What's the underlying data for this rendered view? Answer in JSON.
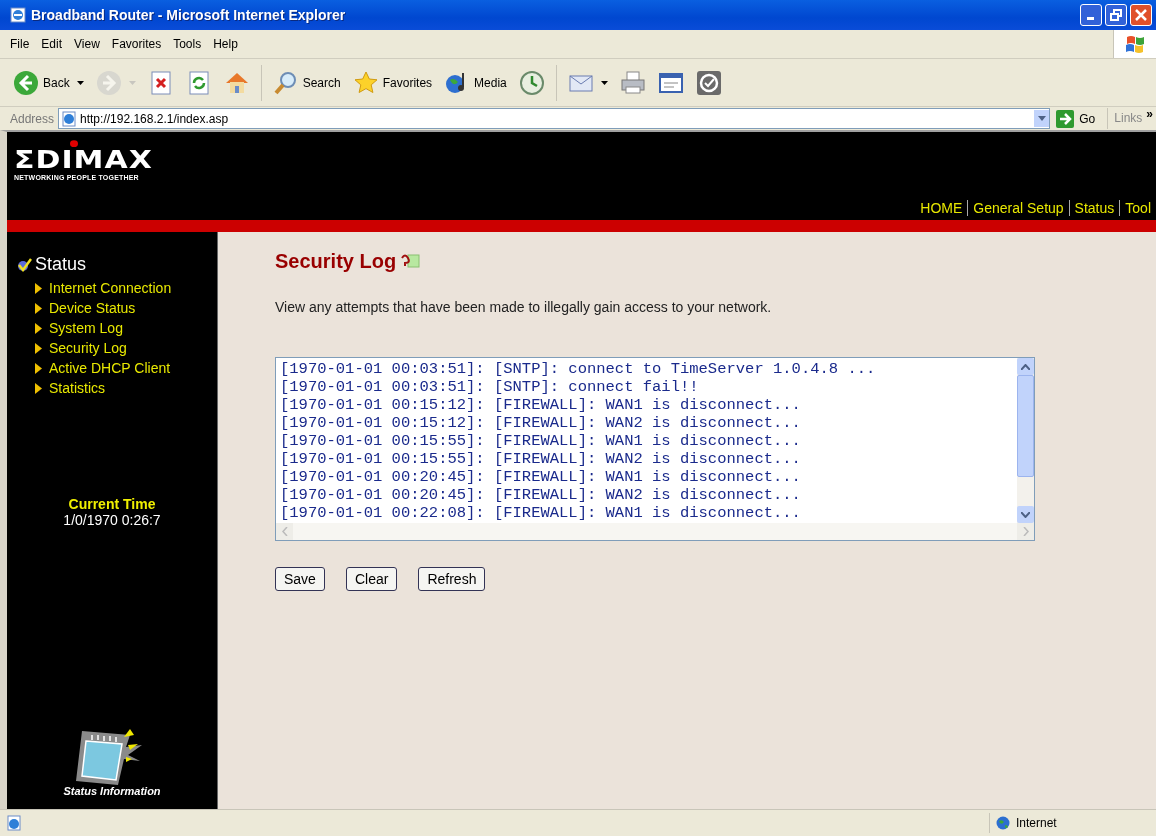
{
  "window": {
    "title": "Broadband Router - Microsoft Internet Explorer"
  },
  "menu": [
    "File",
    "Edit",
    "View",
    "Favorites",
    "Tools",
    "Help"
  ],
  "toolbar": [
    {
      "kind": "back",
      "label": "Back",
      "dropdown": true,
      "disabled": false
    },
    {
      "kind": "forward",
      "dropdown": true,
      "disabled": true
    },
    {
      "kind": "stop",
      "dropdown": false,
      "disabled": false
    },
    {
      "kind": "refresh",
      "dropdown": false,
      "disabled": false
    },
    {
      "kind": "home",
      "dropdown": false,
      "disabled": false
    },
    {
      "kind": "separator"
    },
    {
      "kind": "search",
      "label": "Search",
      "dropdown": false,
      "disabled": false
    },
    {
      "kind": "favorites",
      "label": "Favorites",
      "dropdown": false,
      "disabled": false
    },
    {
      "kind": "media",
      "label": "Media",
      "dropdown": false,
      "disabled": false
    },
    {
      "kind": "history",
      "dropdown": false,
      "disabled": false
    },
    {
      "kind": "separator"
    },
    {
      "kind": "mail",
      "dropdown": true,
      "disabled": false
    },
    {
      "kind": "print",
      "dropdown": false,
      "disabled": false
    },
    {
      "kind": "edit",
      "dropdown": false,
      "disabled": false
    },
    {
      "kind": "messenger",
      "dropdown": false,
      "disabled": false
    }
  ],
  "address": {
    "label": "Address",
    "url": "http://192.168.2.1/index.asp",
    "go": "Go",
    "links": "Links",
    "more": "»"
  },
  "page": {
    "logo": {
      "name": "ΣDIMAX",
      "tagline": "NETWORKING PEOPLE TOGETHER"
    },
    "top_nav": [
      "HOME",
      "General Setup",
      "Status",
      "Tool"
    ],
    "sidebar": {
      "heading": "Status",
      "items": [
        "Internet Connection",
        "Device Status",
        "System Log",
        "Security Log",
        "Active DHCP Client",
        "Statistics"
      ],
      "time_label": "Current Time",
      "time_value": "1/0/1970 0:26:7",
      "caption": "Status Information"
    },
    "content": {
      "title": "Security Log",
      "description": "View any attempts that have been made to illegally gain access to your network.",
      "log": [
        "[1970-01-01 00:03:51]: [SNTP]: connect to TimeServer 1.0.4.8 ...",
        "[1970-01-01 00:03:51]: [SNTP]: connect fail!!",
        "[1970-01-01 00:15:12]: [FIREWALL]: WAN1 is disconnect...",
        "[1970-01-01 00:15:12]: [FIREWALL]: WAN2 is disconnect...",
        "[1970-01-01 00:15:55]: [FIREWALL]: WAN1 is disconnect...",
        "[1970-01-01 00:15:55]: [FIREWALL]: WAN2 is disconnect...",
        "[1970-01-01 00:20:45]: [FIREWALL]: WAN1 is disconnect...",
        "[1970-01-01 00:20:45]: [FIREWALL]: WAN2 is disconnect...",
        "[1970-01-01 00:22:08]: [FIREWALL]: WAN1 is disconnect..."
      ],
      "buttons": [
        "Save",
        "Clear",
        "Refresh"
      ]
    }
  },
  "status_bar": {
    "zone": "Internet"
  }
}
